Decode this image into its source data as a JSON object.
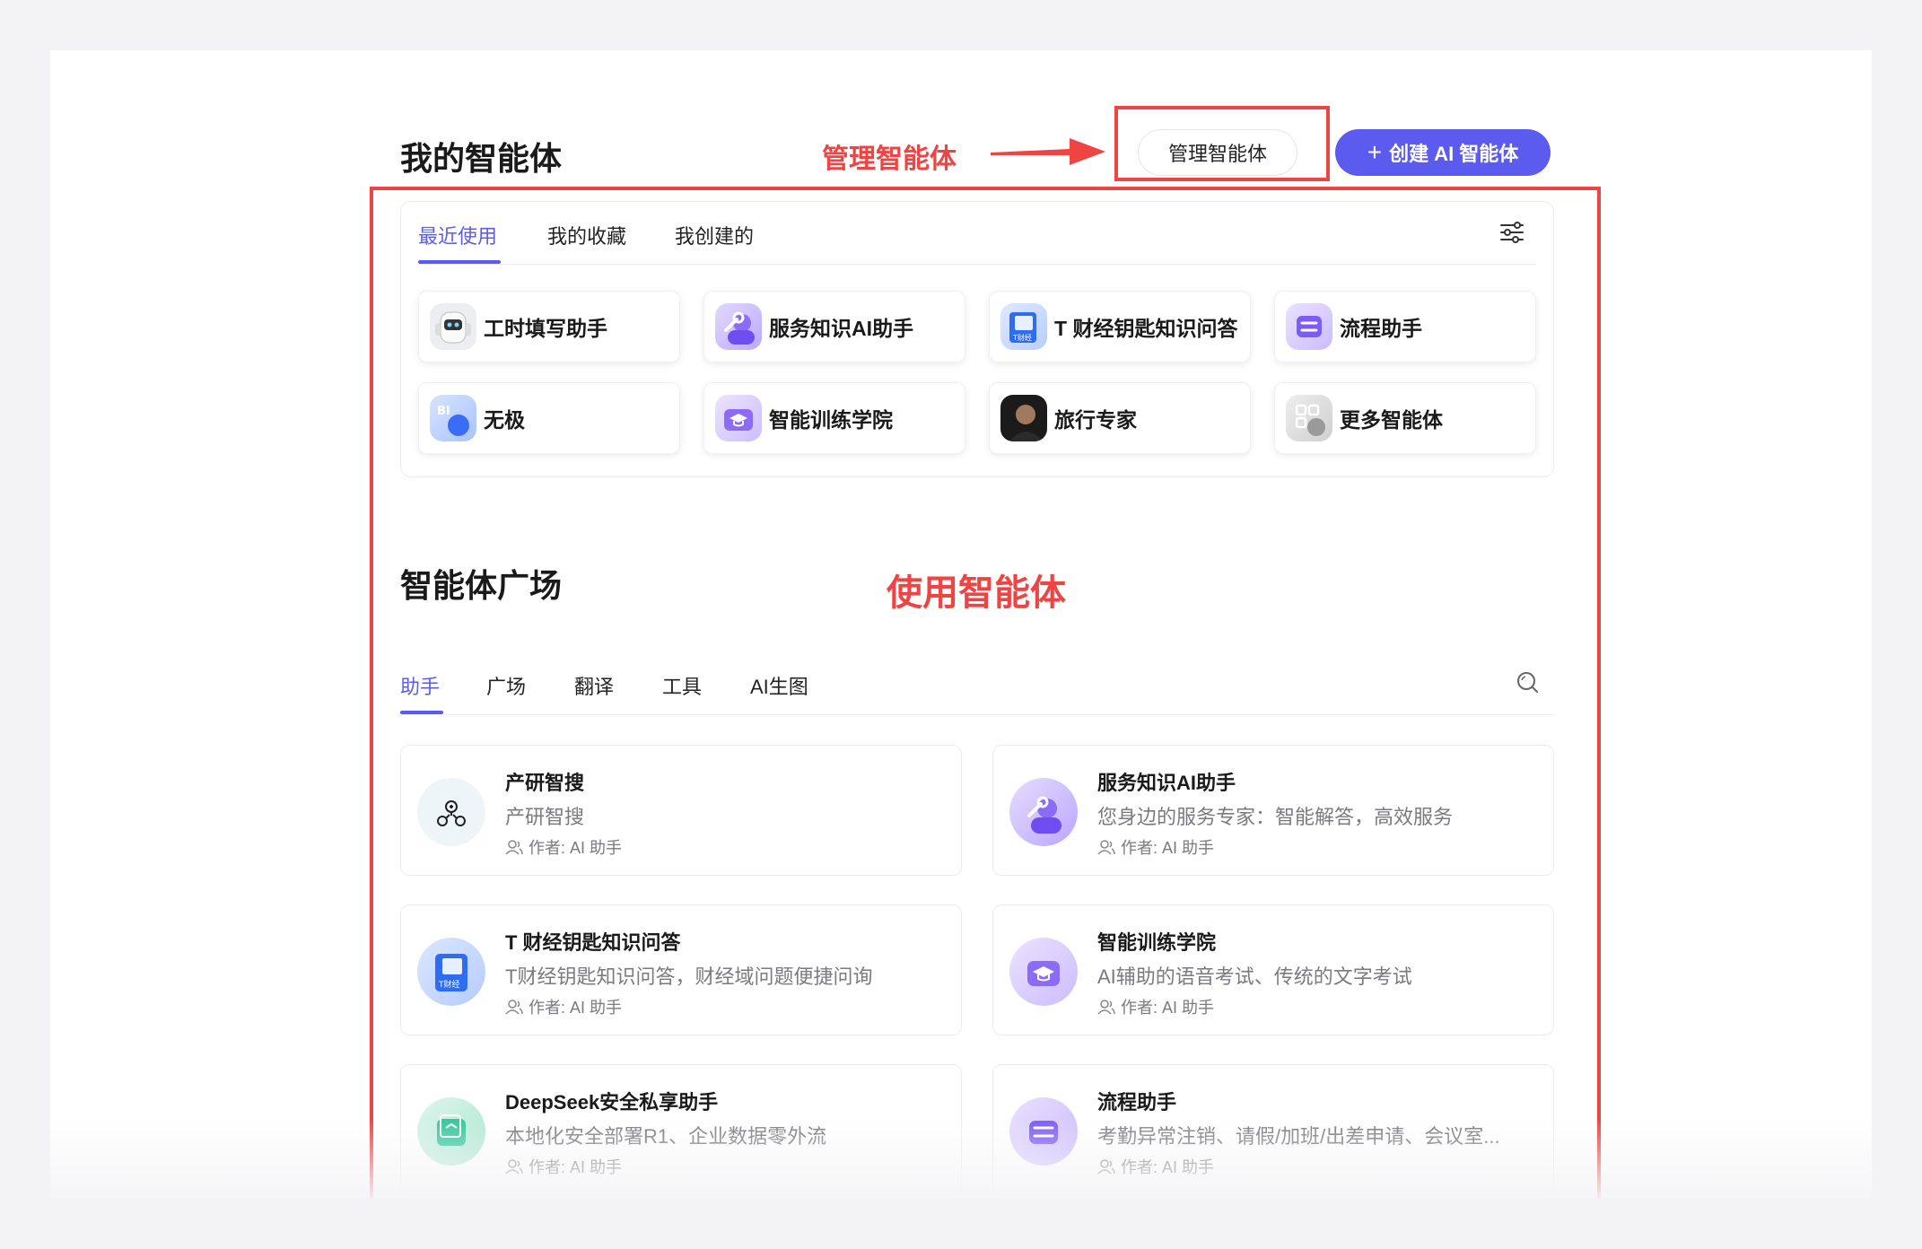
{
  "my_agents": {
    "title": "我的智能体",
    "manage_button": "管理智能体",
    "create_button": "创建 AI 智能体",
    "tabs": [
      {
        "label": "最近使用",
        "active": true
      },
      {
        "label": "我的收藏",
        "active": false
      },
      {
        "label": "我创建的",
        "active": false
      }
    ],
    "filter_icon": "sliders-icon",
    "recent": [
      {
        "name": "工时填写助手",
        "icon": "robot-icon"
      },
      {
        "name": "服务知识AI助手",
        "icon": "wrench-person-icon"
      },
      {
        "name": "T 财经钥匙知识问答",
        "icon": "book-icon"
      },
      {
        "name": "流程助手",
        "icon": "flow-icon"
      },
      {
        "name": "无极",
        "icon": "bi-icon"
      },
      {
        "name": "智能训练学院",
        "icon": "graduation-cap-icon"
      },
      {
        "name": "旅行专家",
        "icon": "avatar-photo-icon"
      },
      {
        "name": "更多智能体",
        "icon": "grid-icon"
      }
    ]
  },
  "annotations": {
    "manage": "管理智能体",
    "use": "使用智能体",
    "color": "#ef4444"
  },
  "plaza": {
    "title": "智能体广场",
    "tabs": [
      {
        "label": "助手",
        "active": true
      },
      {
        "label": "广场",
        "active": false
      },
      {
        "label": "翻译",
        "active": false
      },
      {
        "label": "工具",
        "active": false
      },
      {
        "label": "AI生图",
        "active": false
      }
    ],
    "search_icon": "search-icon",
    "cards": [
      {
        "title": "产研智搜",
        "desc": "产研智搜",
        "author": "作者: AI 助手",
        "icon": "search-nodes-icon"
      },
      {
        "title": "服务知识AI助手",
        "desc": "您身边的服务专家：智能解答，高效服务",
        "author": "作者: AI 助手",
        "icon": "wrench-person-icon"
      },
      {
        "title": "T 财经钥匙知识问答",
        "desc": "T财经钥匙知识问答，财经域问题便捷问询",
        "author": "作者: AI 助手",
        "icon": "book-icon"
      },
      {
        "title": "智能训练学院",
        "desc": "AI辅助的语音考试、传统的文字考试",
        "author": "作者: AI 助手",
        "icon": "graduation-cap-icon"
      },
      {
        "title": "DeepSeek安全私享助手",
        "desc": "本地化安全部署R1、企业数据零外流",
        "author": "作者: AI 助手",
        "icon": "secure-doc-icon"
      },
      {
        "title": "流程助手",
        "desc": "考勤异常注销、请假/加班/出差申请、会议室...",
        "author": "作者: AI 助手",
        "icon": "flow-icon"
      }
    ]
  },
  "colors": {
    "accent": "#5b5bf0",
    "annotation": "#ef4444"
  }
}
